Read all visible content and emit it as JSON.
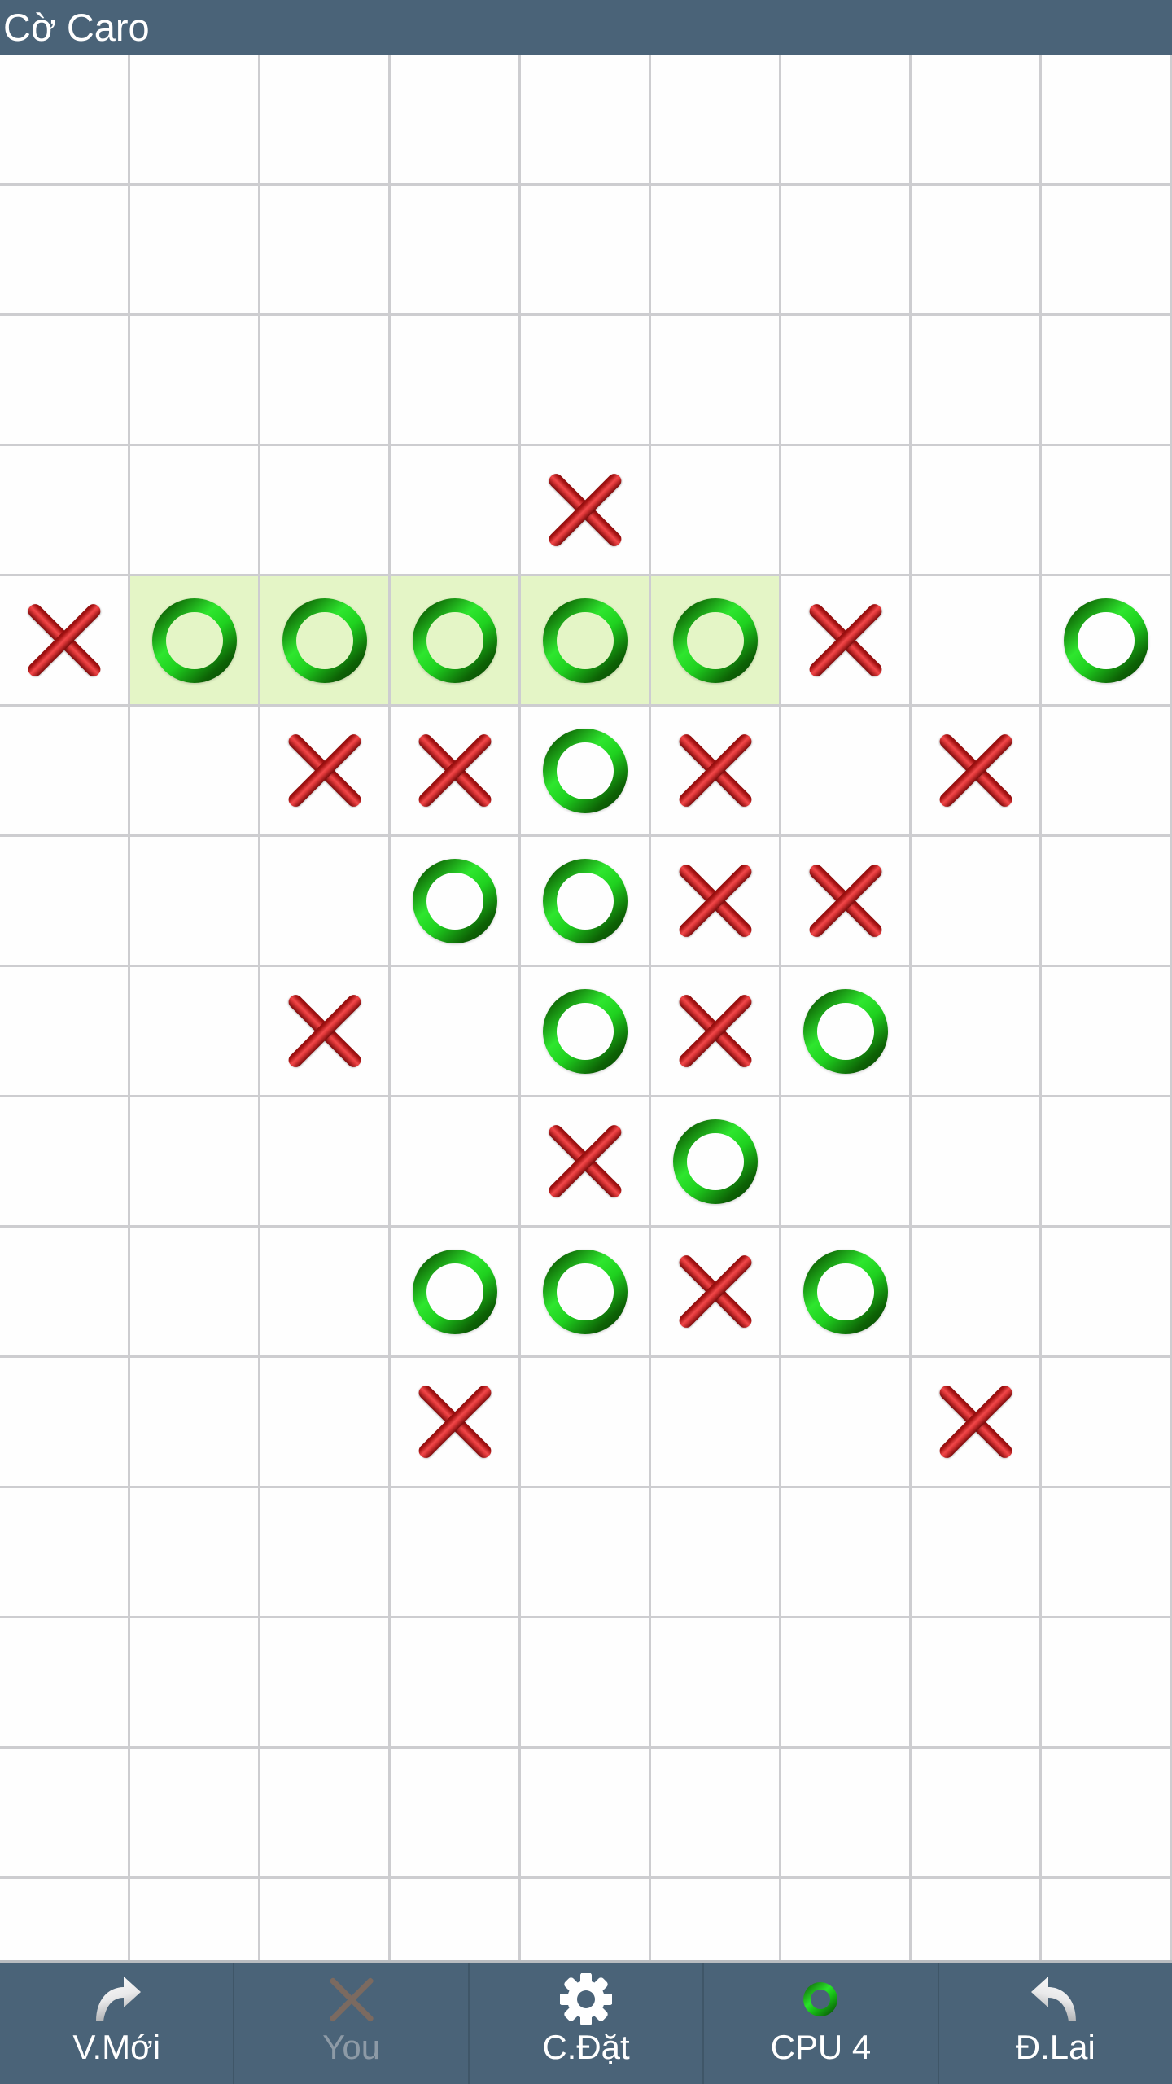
{
  "titlebar": {
    "title": "Cờ Caro"
  },
  "board": {
    "columns": 9,
    "rows": 15,
    "highlight_color": "#e4f5c6",
    "x_color": "#b01414",
    "o_color": "#1fd11f",
    "grid_line_color": "#cdcdd0",
    "cells": [
      [
        "",
        "",
        "",
        "",
        "",
        "",
        "",
        "",
        ""
      ],
      [
        "",
        "",
        "",
        "",
        "",
        "",
        "",
        "",
        ""
      ],
      [
        "",
        "",
        "",
        "",
        "",
        "",
        "",
        "",
        ""
      ],
      [
        "",
        "",
        "",
        "",
        "X",
        "",
        "",
        "",
        ""
      ],
      [
        "X",
        "O",
        "O",
        "O",
        "O",
        "O",
        "X",
        "",
        "O"
      ],
      [
        "",
        "",
        "X",
        "X",
        "O",
        "X",
        "",
        "X",
        ""
      ],
      [
        "",
        "",
        "",
        "O",
        "O",
        "X",
        "X",
        "",
        ""
      ],
      [
        "",
        "",
        "X",
        "",
        "O",
        "X",
        "O",
        "",
        ""
      ],
      [
        "",
        "",
        "",
        "",
        "X",
        "O",
        "",
        "",
        ""
      ],
      [
        "",
        "",
        "",
        "O",
        "O",
        "X",
        "O",
        "",
        ""
      ],
      [
        "",
        "",
        "",
        "X",
        "",
        "",
        "",
        "X",
        ""
      ],
      [
        "",
        "",
        "",
        "",
        "",
        "",
        "",
        "",
        ""
      ],
      [
        "",
        "",
        "",
        "",
        "",
        "",
        "",
        "",
        ""
      ],
      [
        "",
        "",
        "",
        "",
        "",
        "",
        "",
        "",
        ""
      ],
      [
        "",
        "",
        "",
        "",
        "",
        "",
        "",
        "",
        ""
      ]
    ],
    "winning_line": {
      "row": 4,
      "columns": [
        1,
        2,
        3,
        4,
        5
      ],
      "mark": "O"
    }
  },
  "toolbar": {
    "buttons": [
      {
        "label": "V.Mới",
        "icon": "redo-arrow-icon",
        "name": "new-game-button",
        "enabled": true
      },
      {
        "label": "You",
        "icon": "x-mark-icon",
        "name": "player-button",
        "enabled": false
      },
      {
        "label": "C.Đặt",
        "icon": "gear-icon",
        "name": "settings-button",
        "enabled": true
      },
      {
        "label": "CPU 4",
        "icon": "o-mark-icon",
        "name": "cpu-level-button",
        "enabled": true
      },
      {
        "label": "Đ.Lai",
        "icon": "undo-arrow-icon",
        "name": "undo-button",
        "enabled": true
      }
    ]
  },
  "colors": {
    "titlebar_bg": "#4a6378",
    "toolbar_bg": "#4a6378",
    "board_bg": "#fefefe",
    "label_text": "#ffffff",
    "disabled_text": "#8d9aa6"
  }
}
